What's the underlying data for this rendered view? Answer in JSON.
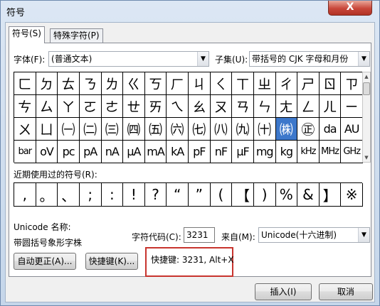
{
  "window": {
    "title": "符号",
    "close_label": "X"
  },
  "tabs": [
    {
      "label": "符号(S)",
      "active": true
    },
    {
      "label": "特殊字符(P)",
      "active": false
    }
  ],
  "font": {
    "label": "字体(F):",
    "value": "(普通文本)"
  },
  "subset": {
    "label": "子集(U):",
    "value": "带括号的 CJK 字母和月份"
  },
  "symbol_grid": [
    [
      "ㄈ",
      "ㄉ",
      "ㄊ",
      "ㄋ",
      "ㄌ",
      "ㄍ",
      "ㄎ",
      "ㄏ",
      "ㄐ",
      "ㄑ",
      "ㄒ",
      "ㄓ",
      "ㄔ",
      "ㄕ",
      "ㄖ",
      "ㄗ"
    ],
    [
      "ㄘ",
      "ㄙ",
      "ㄚ",
      "ㄛ",
      "ㄜ",
      "ㄝ",
      "ㄞ",
      "ㄟ",
      "ㄠ",
      "ㄡ",
      "ㄢ",
      "ㄣ",
      "ㄤ",
      "ㄥ",
      "ㄦ",
      "ㄧ"
    ],
    [
      "ㄨ",
      "ㄩ",
      "㈠",
      "㈡",
      "㈢",
      "㈣",
      "㈤",
      "㈥",
      "㈦",
      "㈧",
      "㈨",
      "㈩",
      "㈱",
      "㊣",
      "da",
      "AU"
    ],
    [
      "bar",
      "oV",
      "pc",
      "pA",
      "nA",
      "μA",
      "mA",
      "kA",
      "pF",
      "nF",
      "μF",
      "mg",
      "kg",
      "kHz",
      "MHz",
      "GHz"
    ]
  ],
  "selected_symbol": "㈱",
  "recent": {
    "label": "近期使用过的符号(R):",
    "symbols": [
      ",",
      "。",
      "、",
      ";",
      ":",
      "!",
      "?",
      "“",
      "”",
      "(",
      "【",
      ")",
      "%",
      "&",
      "】",
      "※"
    ]
  },
  "char_name": {
    "label": "Unicode 名称:",
    "value": "带圆括号象形字株"
  },
  "char_code": {
    "label": "字符代码(C):",
    "value": "3231"
  },
  "from": {
    "label": "来自(M):",
    "value": "Unicode(十六进制)"
  },
  "buttons": {
    "autocorrect": "自动更正(A)...",
    "shortcut_key": "快捷键(K)...",
    "insert": "插入(I)",
    "cancel": "取消"
  },
  "shortcut_text": "快捷键: 3231, Alt+X"
}
